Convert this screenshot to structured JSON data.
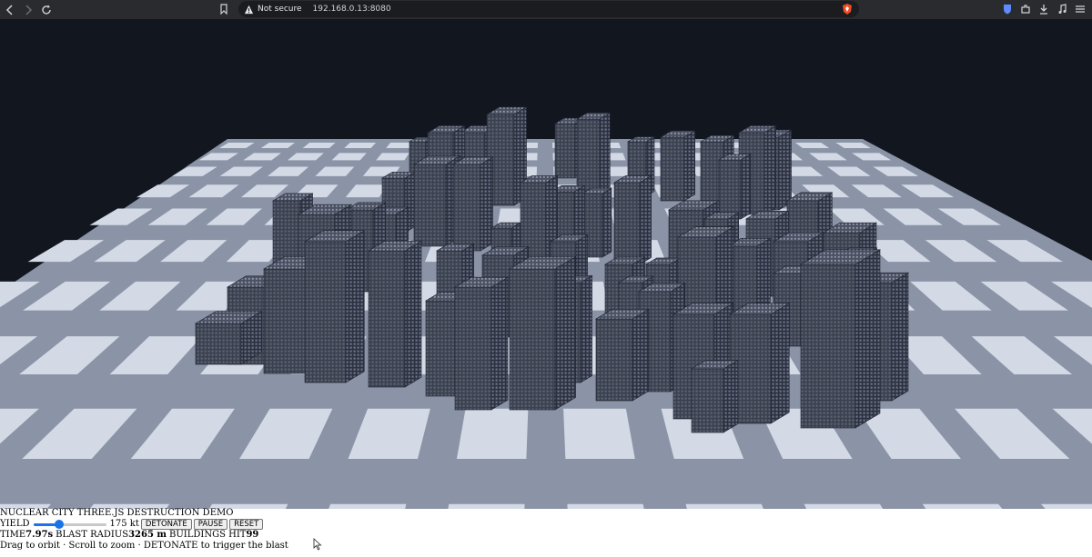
{
  "browser": {
    "security_label": "Not secure",
    "url": "192.168.0.13:8080"
  },
  "hud": {
    "title": "NUCLEAR CITY THREE.JS DESTRUCTION DEMO",
    "yield_label": "YIELD",
    "yield_value": "175 kt",
    "yield_fraction": 0.35,
    "buttons": {
      "detonate": "DETONATE",
      "pause": "PAUSE",
      "reset": "RESET"
    },
    "time_label": "TIME",
    "time_value": "7.97s",
    "blast_label": "BLAST RADIUS",
    "blast_value": "3265 m",
    "buildings_label": "BUILDINGS HIT",
    "buildings_value": "99",
    "help": "Drag to orbit · Scroll to zoom · DETONATE to trigger the blast"
  },
  "colors": {
    "sky": "#12171f",
    "ground": "#8a94a6",
    "block": "#d3dae6",
    "building": "#3c4352",
    "accent": "#1a73e8"
  }
}
